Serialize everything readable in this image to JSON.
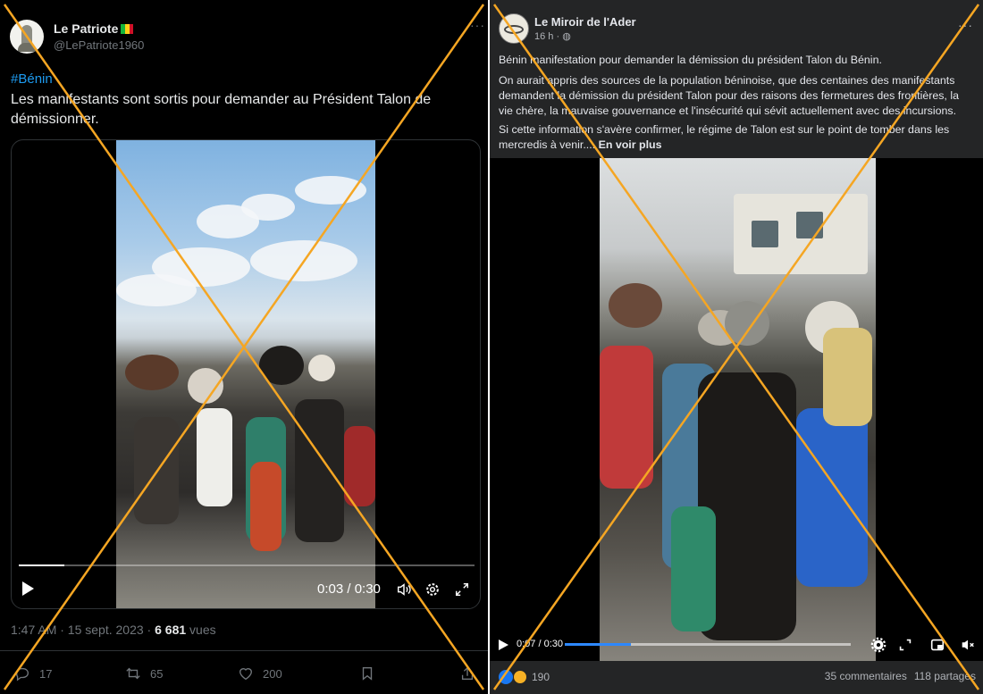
{
  "left_post": {
    "display_name": "Le Patriote",
    "handle": "@LePatriote1960",
    "more_label": "···",
    "hashtag": "#Bénin",
    "text": "Les manifestants sont sortis pour demander au Président Talon de démissionner.",
    "video": {
      "time": "0:03 / 0:30",
      "progress": 0.1
    },
    "meta_time": "1:47 AM · 15 sept. 2023 · ",
    "views_count": "6 681",
    "views_label": " vues",
    "replies": "17",
    "reposts": "65",
    "likes": "200",
    "flag_colors": [
      "#14b53a",
      "#fcd116",
      "#ce1126"
    ]
  },
  "right_post": {
    "page_name": "Le Miroir de l'Ader",
    "time_meta": "16 h · ",
    "more_label": "···",
    "paragraph1": "Bénin manifestation pour demander la démission du président Talon du Bénin.",
    "paragraph2": "On aurait appris des sources de la population béninoise, que des centaines des manifestants demandent la démission du président Talon pour des raisons des fermetures des frontières, la vie chère, la mauvaise gouvernance et l'insécurité qui sévit actuellement avec des incursions.",
    "paragraph3": "Si cette information s'avère confirmer, le régime de Talon est sur le point de tomber dans les mercredis à venir.... ",
    "see_more": "En voir plus",
    "video": {
      "time": "0:07 / 0:30",
      "progress": 0.23
    },
    "reactions_count": "190",
    "comments": "35 commentaires",
    "shares": "118 partages"
  },
  "overlay": {
    "cross_color": "#f5a623"
  }
}
